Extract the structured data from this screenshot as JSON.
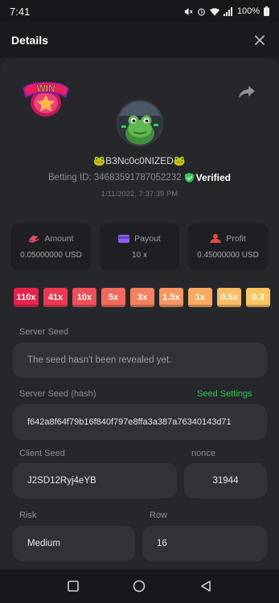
{
  "status_bar": {
    "time": "7:41",
    "battery": "100%"
  },
  "header": {
    "title": "Details"
  },
  "profile": {
    "username": "🐸B3Nc0c0NIZED🐸",
    "betting_id": "Betting ID: 34683591787052232",
    "verified_label": "Verified",
    "date": "1/11/2022, 7:37:39 PM"
  },
  "badge": {
    "text": "WIN"
  },
  "stats": [
    {
      "label": "Amount",
      "value": "0.05000000 USD",
      "icon": "cash-icon",
      "color": "#e8476a"
    },
    {
      "label": "Payout",
      "value": "10 x",
      "icon": "wallet-icon",
      "color": "#8b5cf6"
    },
    {
      "label": "Profit",
      "value": "0.45000000 USD",
      "icon": "profit-icon",
      "color": "#e8473f"
    }
  ],
  "multipliers": [
    {
      "label": "110x",
      "color": "#e5244a"
    },
    {
      "label": "41x",
      "color": "#ea3a52"
    },
    {
      "label": "10x",
      "color": "#ef4f5a"
    },
    {
      "label": "5x",
      "color": "#f26a5c"
    },
    {
      "label": "3x",
      "color": "#f5825e"
    },
    {
      "label": "1.5x",
      "color": "#f79760"
    },
    {
      "label": "1x",
      "color": "#f9aa62"
    },
    {
      "label": "0.5x",
      "color": "#fbbb62"
    },
    {
      "label": "0.3",
      "color": "#fcc664"
    }
  ],
  "fields": {
    "server_seed_label": "Server Seed",
    "server_seed_value": "The seed hasn't been revealed yet.",
    "server_seed_hash_label": "Server Seed (hash)",
    "seed_settings_link": "Seed Settings",
    "server_seed_hash_value": "f642a8f64f79b16f840f797e8ffa3a387a76340143d71",
    "client_seed_label": "Client Seed",
    "client_seed_value": "J2SD12Ryj4eYB",
    "nonce_label": "nonce",
    "nonce_value": "31944",
    "risk_label": "Risk",
    "risk_value": "Medium",
    "row_label": "Row",
    "row_value": "16"
  }
}
